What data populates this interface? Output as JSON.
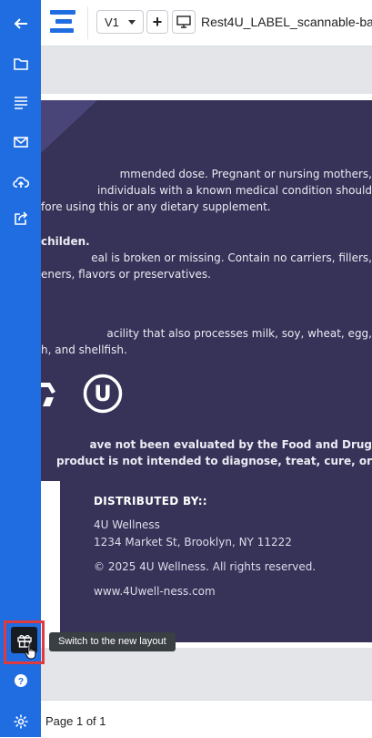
{
  "header": {
    "version_label": "V1",
    "add_label": "+",
    "document_title": "Rest4U_LABEL_scannable-ba"
  },
  "sidebar": {
    "items": [
      {
        "icon": "back-arrow-icon"
      },
      {
        "icon": "folder-icon"
      },
      {
        "icon": "lines-icon"
      },
      {
        "icon": "mail-icon"
      },
      {
        "icon": "cloud-upload-icon"
      },
      {
        "icon": "share-icon"
      },
      {
        "icon": "gift-icon"
      },
      {
        "icon": "help-icon"
      },
      {
        "icon": "settings-icon"
      }
    ]
  },
  "label": {
    "lines": [
      "mmended dose. Pregnant or nursing mothers,",
      "individuals with a known medical condition should",
      "fore using this or any dietary supplement.",
      "childen.",
      "eal is broken or missing. Contain no carriers, fillers,",
      "eners, flavors or preservatives.",
      "acility that also processes milk, soy, wheat, egg,",
      "h, and shellfish.",
      "ave not been evaluated by the Food and Drug",
      "product is not intended to diagnose, treat, cure, or"
    ],
    "distributed_heading": "DISTRIBUTED BY::",
    "company": "4U Wellness",
    "address": "1234 Market St, Brooklyn, NY 11222",
    "copyright": "© 2025 4U Wellness. All rights reserved.",
    "website": "www.4Uwell-ness.com",
    "kosher_symbol": "U"
  },
  "tooltip": {
    "text": "Switch to the new layout"
  },
  "footer": {
    "page_count": "Page 1 of 1"
  },
  "colors": {
    "sidebar": "#1f6de0",
    "label_background": "#363258",
    "highlight": "#e0393e"
  }
}
